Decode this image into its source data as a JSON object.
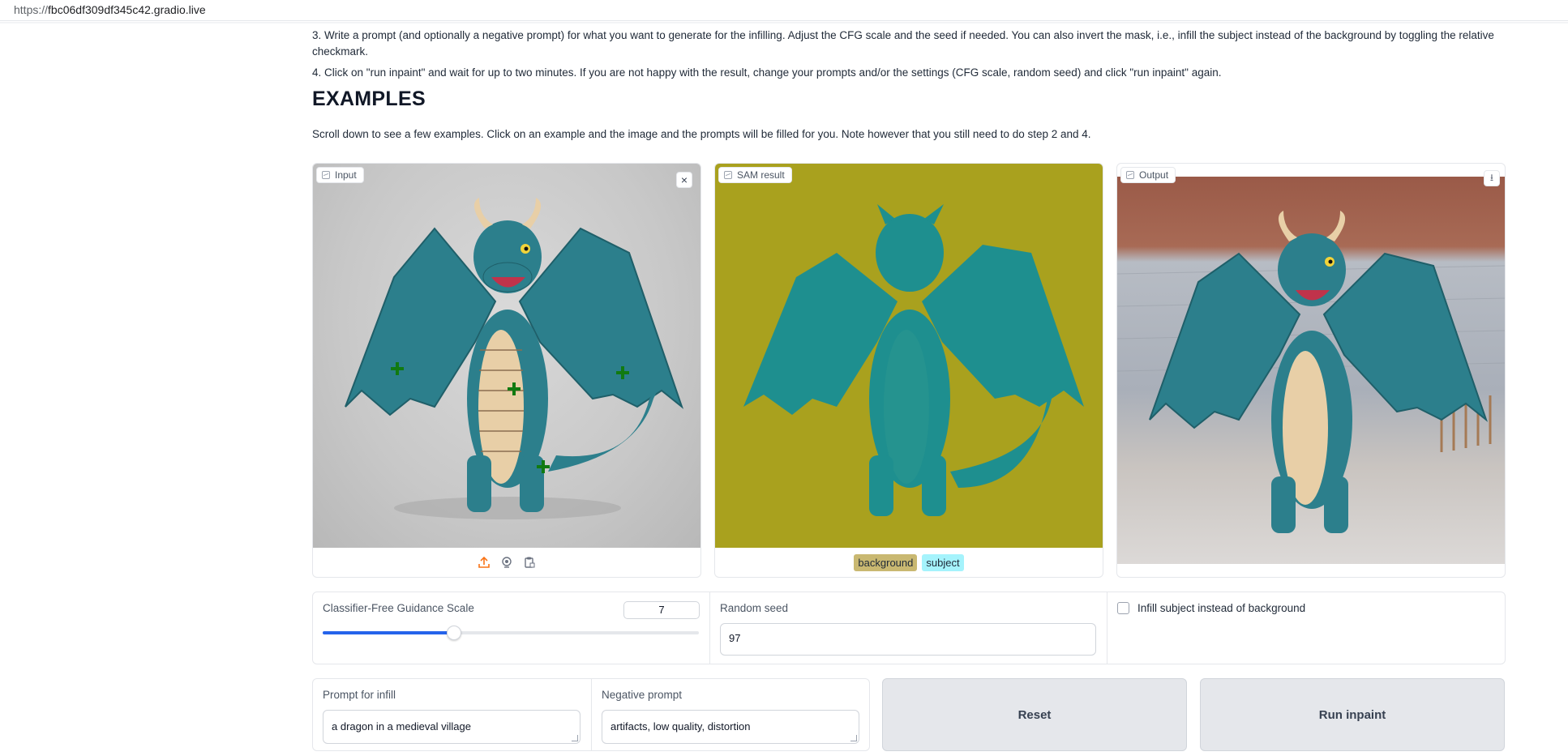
{
  "browser": {
    "url_proto": "https://",
    "url_host": "fbc06df309df345c42.gradio.live"
  },
  "instructions": {
    "step3": "3. Write a prompt (and optionally a negative prompt) for what you want to generate for the infilling. Adjust the CFG scale and the seed if needed. You can also invert the mask, i.e., infill the subject instead of the background by toggling the relative checkmark.",
    "step4": "4. Click on \"run inpaint\" and wait for up to two minutes. If you are not happy with the result, change your prompts and/or the settings (CFG scale, random seed) and click \"run inpaint\" again."
  },
  "examples": {
    "heading": "EXAMPLES",
    "note": "Scroll down to see a few examples. Click on an example and the image and the prompts will be filled for you. Note however that you still need to do step 2 and 4."
  },
  "panels": {
    "input_label": "Input",
    "sam_label": "SAM result",
    "output_label": "Output",
    "legend_background": "background",
    "legend_subject": "subject",
    "colors": {
      "sam_bg": "#a9a11e",
      "sam_dragon": "#1e8f8f",
      "chip_background": "#c9b871",
      "chip_subject": "#a5f3fc",
      "dragon": "#2c7f8c",
      "belly": "#e8cfa7",
      "point": "#117a11"
    }
  },
  "settings": {
    "cfg_label": "Classifier-Free Guidance Scale",
    "cfg_value": "7",
    "cfg_fraction": 0.35,
    "seed_label": "Random seed",
    "seed_value": "97",
    "invert_label": "Infill subject instead of background"
  },
  "prompts": {
    "infill_label": "Prompt for infill",
    "infill_value": "a dragon in a medieval village",
    "negative_label": "Negative prompt",
    "negative_value": "artifacts, low quality, distortion"
  },
  "buttons": {
    "reset": "Reset",
    "run": "Run inpaint"
  }
}
